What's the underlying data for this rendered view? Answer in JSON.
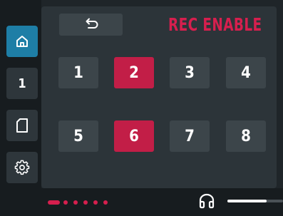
{
  "sidebar": {
    "items": [
      {
        "icon": "home-icon",
        "active": true
      },
      {
        "label": "1"
      },
      {
        "icon": "sd-card-icon"
      },
      {
        "icon": "gear-icon"
      }
    ]
  },
  "header": {
    "back_icon": "undo-arrow-icon",
    "title": "REC ENABLE"
  },
  "tracks": [
    {
      "label": "1",
      "armed": false
    },
    {
      "label": "2",
      "armed": true
    },
    {
      "label": "3",
      "armed": false
    },
    {
      "label": "4",
      "armed": false
    },
    {
      "label": "5",
      "armed": false
    },
    {
      "label": "6",
      "armed": true
    },
    {
      "label": "7",
      "armed": false
    },
    {
      "label": "8",
      "armed": false
    }
  ],
  "footer": {
    "pages": 6,
    "current_page": 1,
    "headphone_icon": "headphones-icon",
    "headphone_level": 0.7
  },
  "colors": {
    "accent": "#d61f4e",
    "armed": "#c21e47",
    "active_nav": "#1e7ea6",
    "button": "#3c454a",
    "panel": "#2c3439",
    "background": "#1f2529"
  }
}
